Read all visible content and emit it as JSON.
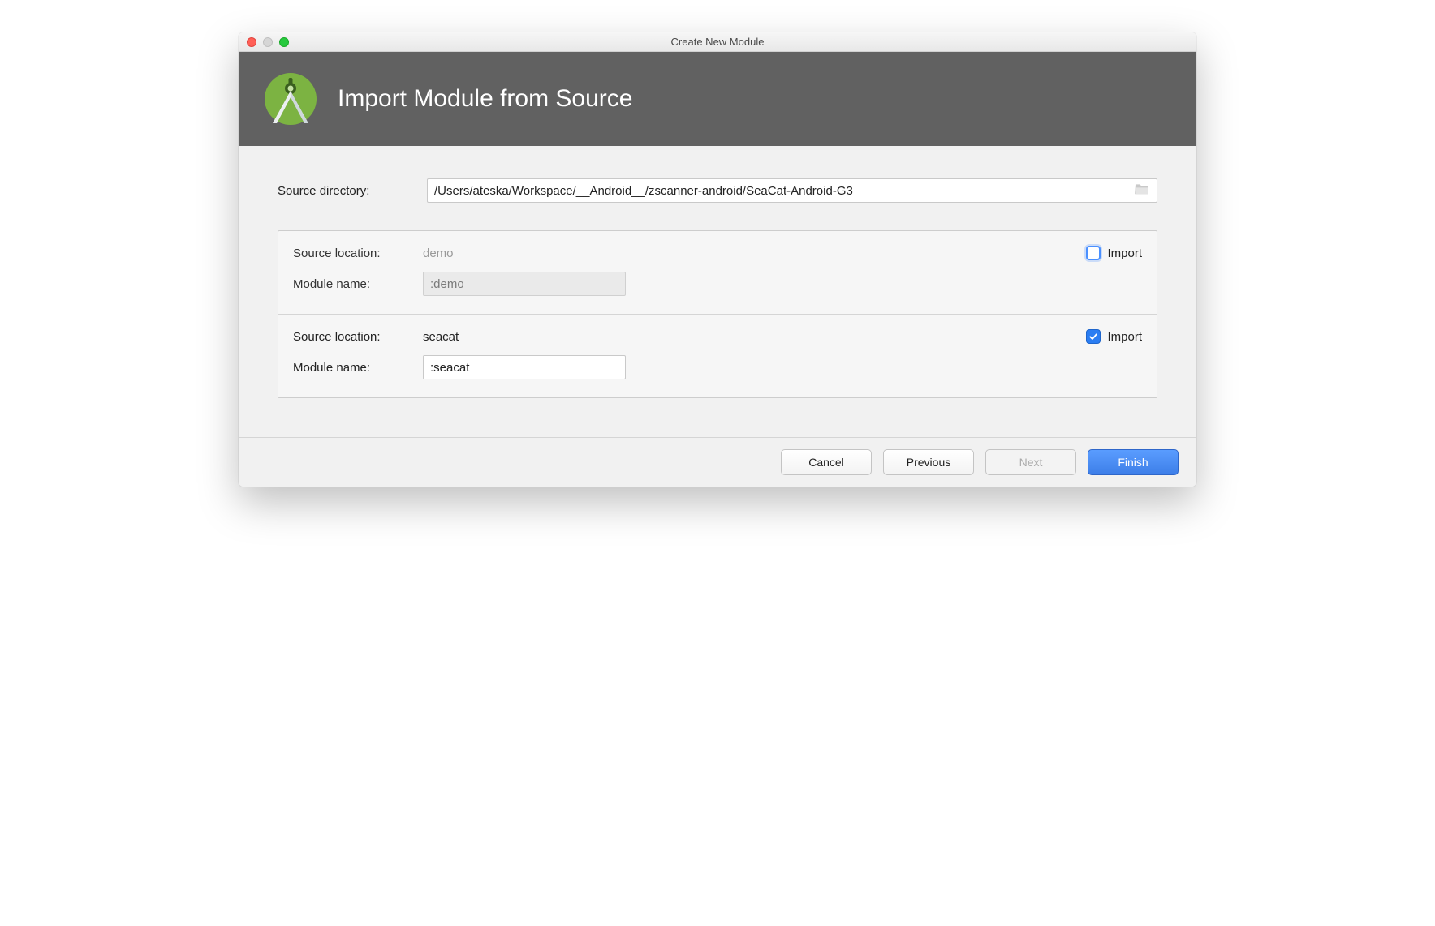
{
  "window": {
    "title": "Create New Module"
  },
  "header": {
    "title": "Import Module from Source"
  },
  "source": {
    "label": "Source directory:",
    "path": "/Users/ateska/Workspace/__Android__/zscanner-android/SeaCat-Android-G3"
  },
  "labels": {
    "source_location": "Source location:",
    "module_name": "Module name:",
    "import": "Import"
  },
  "modules": [
    {
      "location": "demo",
      "name": ":demo",
      "import": false
    },
    {
      "location": "seacat",
      "name": ":seacat",
      "import": true
    }
  ],
  "buttons": {
    "cancel": "Cancel",
    "previous": "Previous",
    "next": "Next",
    "finish": "Finish"
  }
}
